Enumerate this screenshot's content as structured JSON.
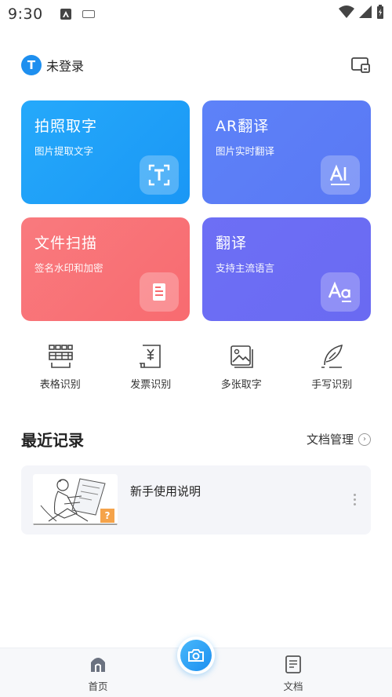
{
  "status_bar": {
    "time": "9:30"
  },
  "header": {
    "login_text": "未登录",
    "logo_letter": "T"
  },
  "cards": [
    {
      "title": "拍照取字",
      "subtitle": "图片提取文字",
      "icon": "text-recognize-icon",
      "color": "#1e9ff8"
    },
    {
      "title": "AR翻译",
      "subtitle": "图片实时翻译",
      "icon": "ai-translate-icon",
      "color": "#5b7ff6"
    },
    {
      "title": "文件扫描",
      "subtitle": "签名水印和加密",
      "icon": "document-scan-icon",
      "color": "#f87377"
    },
    {
      "title": "翻译",
      "subtitle": "支持主流语言",
      "icon": "aa-translate-icon",
      "color": "#6b6cf4"
    }
  ],
  "tools": [
    {
      "label": "表格识别",
      "icon": "table-icon"
    },
    {
      "label": "发票识别",
      "icon": "invoice-icon"
    },
    {
      "label": "多张取字",
      "icon": "multi-image-icon"
    },
    {
      "label": "手写识别",
      "icon": "handwriting-icon"
    }
  ],
  "recent": {
    "title": "最近记录",
    "manage_label": "文档管理",
    "records": [
      {
        "name": "新手使用说明",
        "badge": "?"
      }
    ]
  },
  "bottom_nav": {
    "home_label": "首页",
    "docs_label": "文档"
  }
}
